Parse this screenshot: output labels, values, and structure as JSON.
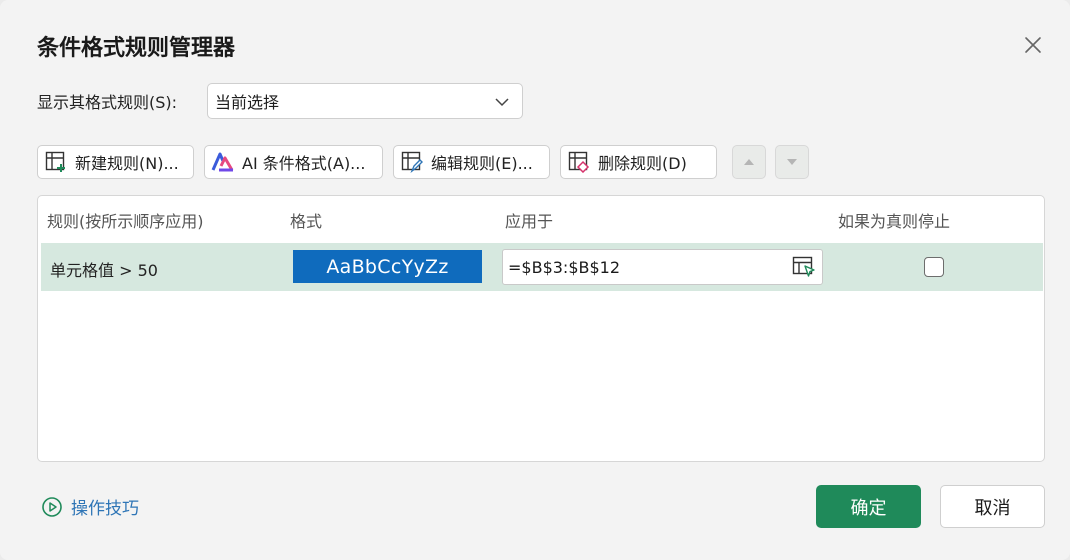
{
  "dialog": {
    "title": "条件格式规则管理器"
  },
  "show_rules": {
    "label": "显示其格式规则(S):",
    "selected": "当前选择"
  },
  "toolbar": {
    "new_rule": "新建规则(N)...",
    "ai_format": "AI 条件格式(A)...",
    "edit_rule": "编辑规则(E)...",
    "delete_rule": "删除规则(D)"
  },
  "table": {
    "headers": {
      "rule": "规则(按所示顺序应用)",
      "format": "格式",
      "applies_to": "应用于",
      "stop_if_true": "如果为真则停止"
    },
    "rows": [
      {
        "condition": "单元格值 > 50",
        "preview": "AaBbCcYyZz",
        "range": "=$B$3:$B$12",
        "stop_if_true": false
      }
    ]
  },
  "footer": {
    "tips": "操作技巧",
    "ok": "确定",
    "cancel": "取消"
  },
  "colors": {
    "accent_green": "#1f8a5a",
    "selected_row": "#d6e8df",
    "format_preview_bg": "#0f6bbd",
    "link": "#2e75b6"
  }
}
